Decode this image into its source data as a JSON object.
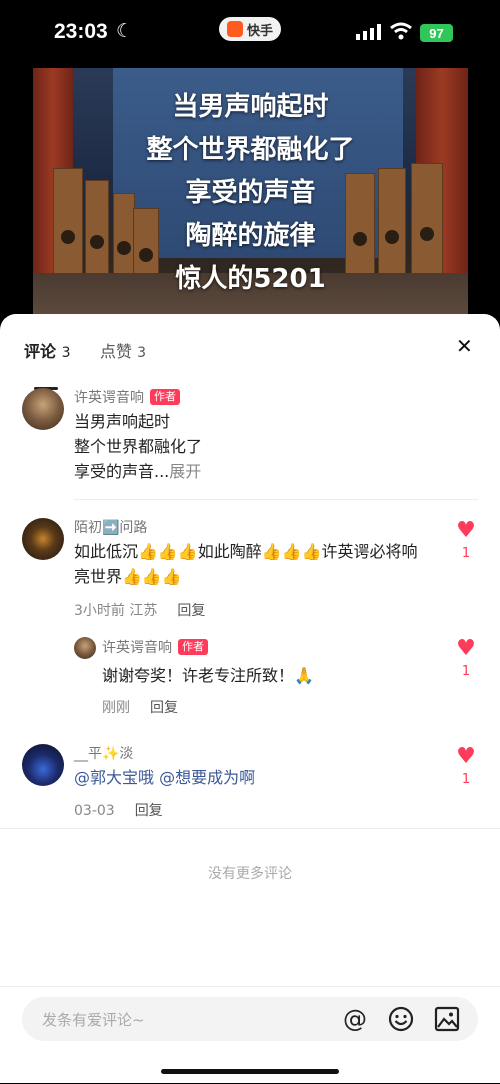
{
  "status": {
    "time": "23:03",
    "app_name": "快手",
    "battery": "97"
  },
  "video": {
    "lines": [
      "当男声响起时",
      "整个世界都融化了",
      "享受的声音",
      "陶醉的旋律",
      "惊人的5201"
    ]
  },
  "tabs": [
    {
      "label": "评论",
      "count": "3"
    },
    {
      "label": "点赞",
      "count": "3"
    }
  ],
  "comments": [
    {
      "author": "许英谔音响",
      "badge": "作者",
      "lines": [
        "当男声响起时",
        "整个世界都融化了",
        "享受的声音..."
      ],
      "expand": "展开"
    },
    {
      "author": "陌初➡️问路",
      "text": "如此低沉👍👍👍如此陶醉👍👍👍许英谔必将响亮世界👍👍👍",
      "time": "3小时前 江苏",
      "reply": "回复",
      "likes": "1",
      "sub": {
        "author": "许英谔音响",
        "badge": "作者",
        "text": "谢谢夸奖！许老专注所致！🙏",
        "time": "刚刚",
        "reply": "回复",
        "likes": "1"
      }
    },
    {
      "author": "__平✨淡",
      "mentions": [
        "@郭大宝哦",
        "@想要成为啊"
      ],
      "time": "03-03",
      "reply": "回复",
      "likes": "1"
    }
  ],
  "no_more": "没有更多评论",
  "input": {
    "placeholder": "发条有爱评论~"
  },
  "colors": {
    "accent": "#ff3b5c",
    "battery": "#30c65a",
    "mention": "#3b5998"
  }
}
